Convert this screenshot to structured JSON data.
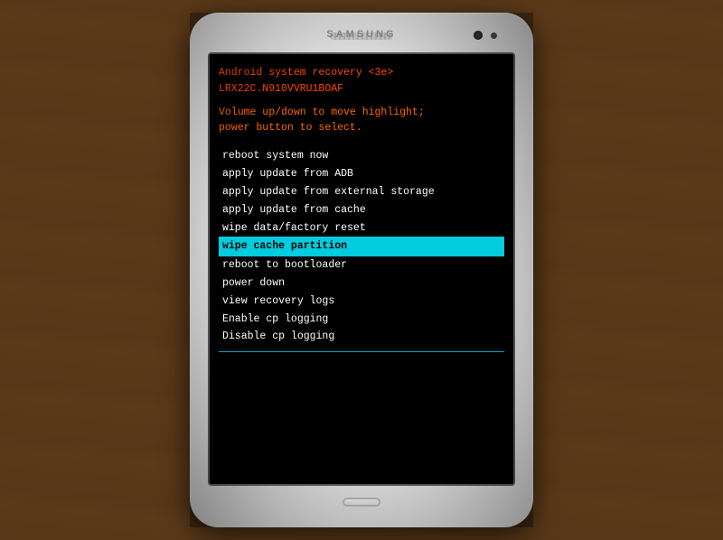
{
  "background": {
    "color": "#5a3a1a"
  },
  "phone": {
    "brand": "SAMSUNG",
    "screen": {
      "header": {
        "line1": "Android system recovery <3e>",
        "line2": "LRX22C.N910VVRU1BOAF"
      },
      "instructions": {
        "line1": "Volume up/down to move highlight;",
        "line2": "power button to select."
      },
      "menu_items": [
        {
          "id": "reboot-system",
          "label": "reboot system now",
          "highlighted": false
        },
        {
          "id": "apply-adb",
          "label": "apply update from ADB",
          "highlighted": false
        },
        {
          "id": "apply-external",
          "label": "apply update from external storage",
          "highlighted": false
        },
        {
          "id": "apply-cache",
          "label": "apply update from cache",
          "highlighted": false
        },
        {
          "id": "wipe-data",
          "label": "wipe data/factory reset",
          "highlighted": false
        },
        {
          "id": "wipe-cache",
          "label": "wipe cache partition",
          "highlighted": true
        },
        {
          "id": "reboot-bootloader",
          "label": "reboot to bootloader",
          "highlighted": false
        },
        {
          "id": "power-down",
          "label": "power down",
          "highlighted": false
        },
        {
          "id": "view-recovery-logs",
          "label": "view recovery logs",
          "highlighted": false
        },
        {
          "id": "enable-cp-logging",
          "label": "Enable cp logging",
          "highlighted": false
        },
        {
          "id": "disable-cp-logging",
          "label": "Disable cp logging",
          "highlighted": false
        }
      ]
    }
  }
}
